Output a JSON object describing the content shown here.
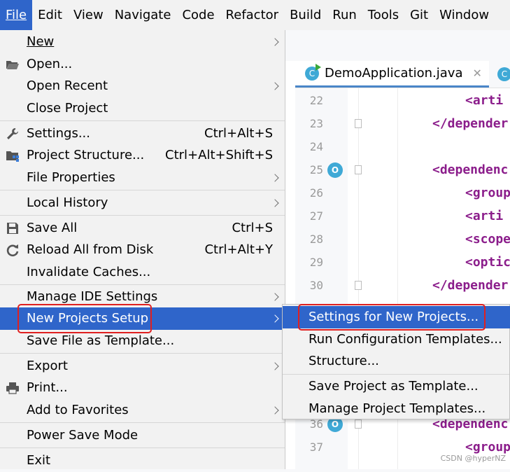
{
  "menubar": {
    "items": [
      {
        "label": "File",
        "active": true
      },
      {
        "label": "Edit"
      },
      {
        "label": "View"
      },
      {
        "label": "Navigate"
      },
      {
        "label": "Code"
      },
      {
        "label": "Refactor"
      },
      {
        "label": "Build"
      },
      {
        "label": "Run"
      },
      {
        "label": "Tools"
      },
      {
        "label": "Git"
      },
      {
        "label": "Window"
      }
    ]
  },
  "file_menu": {
    "items": [
      {
        "label": "New",
        "submenu": true
      },
      {
        "label": "Open...",
        "icon": "folder-open-icon"
      },
      {
        "label": "Open Recent",
        "submenu": true
      },
      {
        "label": "Close Project"
      },
      {
        "label": "Settings...",
        "shortcut": "Ctrl+Alt+S",
        "icon": "wrench-icon"
      },
      {
        "label": "Project Structure...",
        "shortcut": "Ctrl+Alt+Shift+S",
        "icon": "project-structure-icon"
      },
      {
        "label": "File Properties",
        "submenu": true
      },
      {
        "label": "Local History",
        "submenu": true
      },
      {
        "label": "Save All",
        "shortcut": "Ctrl+S",
        "icon": "save-icon"
      },
      {
        "label": "Reload All from Disk",
        "shortcut": "Ctrl+Alt+Y",
        "icon": "reload-icon"
      },
      {
        "label": "Invalidate Caches..."
      },
      {
        "label": "Manage IDE Settings",
        "submenu": true
      },
      {
        "label": "New Projects Setup",
        "submenu": true,
        "selected": true
      },
      {
        "label": "Save File as Template..."
      },
      {
        "label": "Export",
        "submenu": true
      },
      {
        "label": "Print...",
        "icon": "printer-icon"
      },
      {
        "label": "Add to Favorites",
        "submenu": true
      },
      {
        "label": "Power Save Mode"
      },
      {
        "label": "Exit"
      }
    ]
  },
  "submenu": {
    "items": [
      {
        "label": "Settings for New Projects...",
        "selected": true
      },
      {
        "label": "Run Configuration Templates..."
      },
      {
        "label": "Structure..."
      },
      {
        "label": "Save Project as Template..."
      },
      {
        "label": "Manage Project Templates..."
      }
    ]
  },
  "editor": {
    "tab_active": "DemoApplication.java",
    "badge_letter": "C",
    "gutter_icon_letter": "O",
    "lines": [
      {
        "n": "22",
        "code": "<arti"
      },
      {
        "n": "23",
        "code": "</depender"
      },
      {
        "n": "24",
        "code": ""
      },
      {
        "n": "25",
        "code": "<dependenc"
      },
      {
        "n": "26",
        "code": "<group"
      },
      {
        "n": "27",
        "code": "<arti"
      },
      {
        "n": "28",
        "code": "<scope"
      },
      {
        "n": "29",
        "code": "<optic"
      },
      {
        "n": "30",
        "code": "</depender"
      },
      {
        "n": "36",
        "code": "<dependenc"
      },
      {
        "n": "37",
        "code": "<group"
      }
    ]
  },
  "watermark": "CSDN @hyperNZ",
  "colors": {
    "selection": "#2f65ca",
    "highlight_box": "#e02020",
    "xml_tag": "#8b1d8b"
  }
}
